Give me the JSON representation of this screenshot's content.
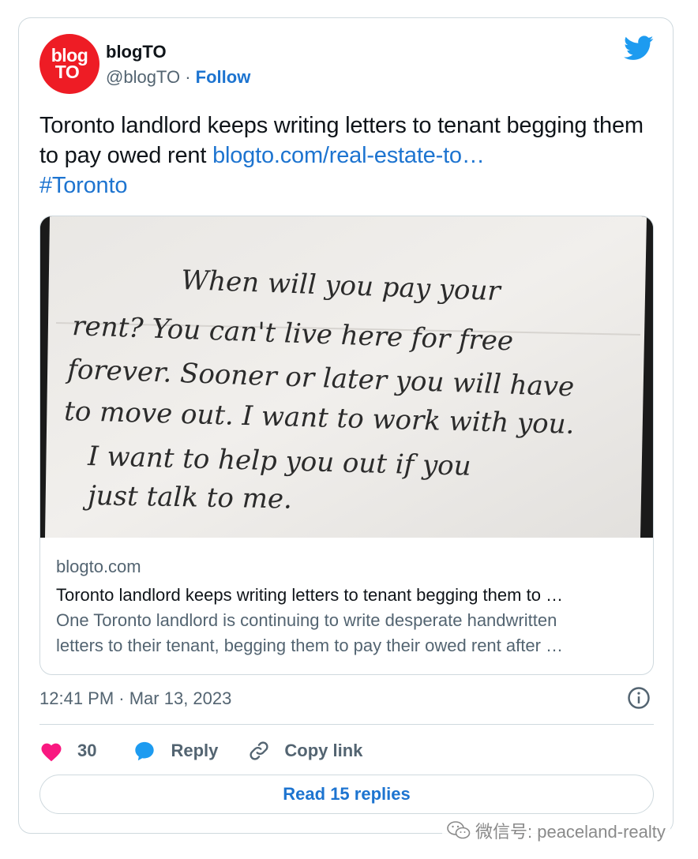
{
  "account": {
    "avatar_text_line1": "blog",
    "avatar_text_line2": "TO",
    "name": "blogTO",
    "handle": "@blogTO",
    "separator": " · ",
    "follow_label": "Follow"
  },
  "tweet": {
    "text": "Toronto landlord keeps writing letters to tenant begging them to pay owed rent ",
    "link_text": "blogto.com/real-estate-to…",
    "hashtag": "#Toronto"
  },
  "photo_letter_lines": [
    "When will you pay your",
    "rent? You can't live here for free",
    "forever. Sooner or later you will have",
    "to move out. I want to work with you.",
    "I want to help you out if you",
    "just talk to me."
  ],
  "link_card": {
    "domain": "blogto.com",
    "title": "Toronto landlord keeps writing letters to tenant begging them to …",
    "description_line1": "One Toronto landlord is continuing to write desperate handwritten",
    "description_line2": "letters to their tenant, begging them to pay their owed rent after …"
  },
  "meta": {
    "timestamp": "12:41 PM · Mar 13, 2023"
  },
  "actions": {
    "like_count": "30",
    "reply_label": "Reply",
    "copy_link_label": "Copy link"
  },
  "read_replies_label": "Read 15 replies",
  "watermark": {
    "text": "微信号: peaceland-realty"
  },
  "colors": {
    "link_blue": "#1d74d0",
    "twitter_blue": "#1d9bf0",
    "heart_pink": "#f91880",
    "avatar_red": "#ee1c25",
    "muted_text": "#536471"
  },
  "icons": [
    "twitter-bird-icon",
    "info-icon",
    "heart-icon",
    "reply-bubble-icon",
    "link-icon",
    "wechat-icon"
  ]
}
